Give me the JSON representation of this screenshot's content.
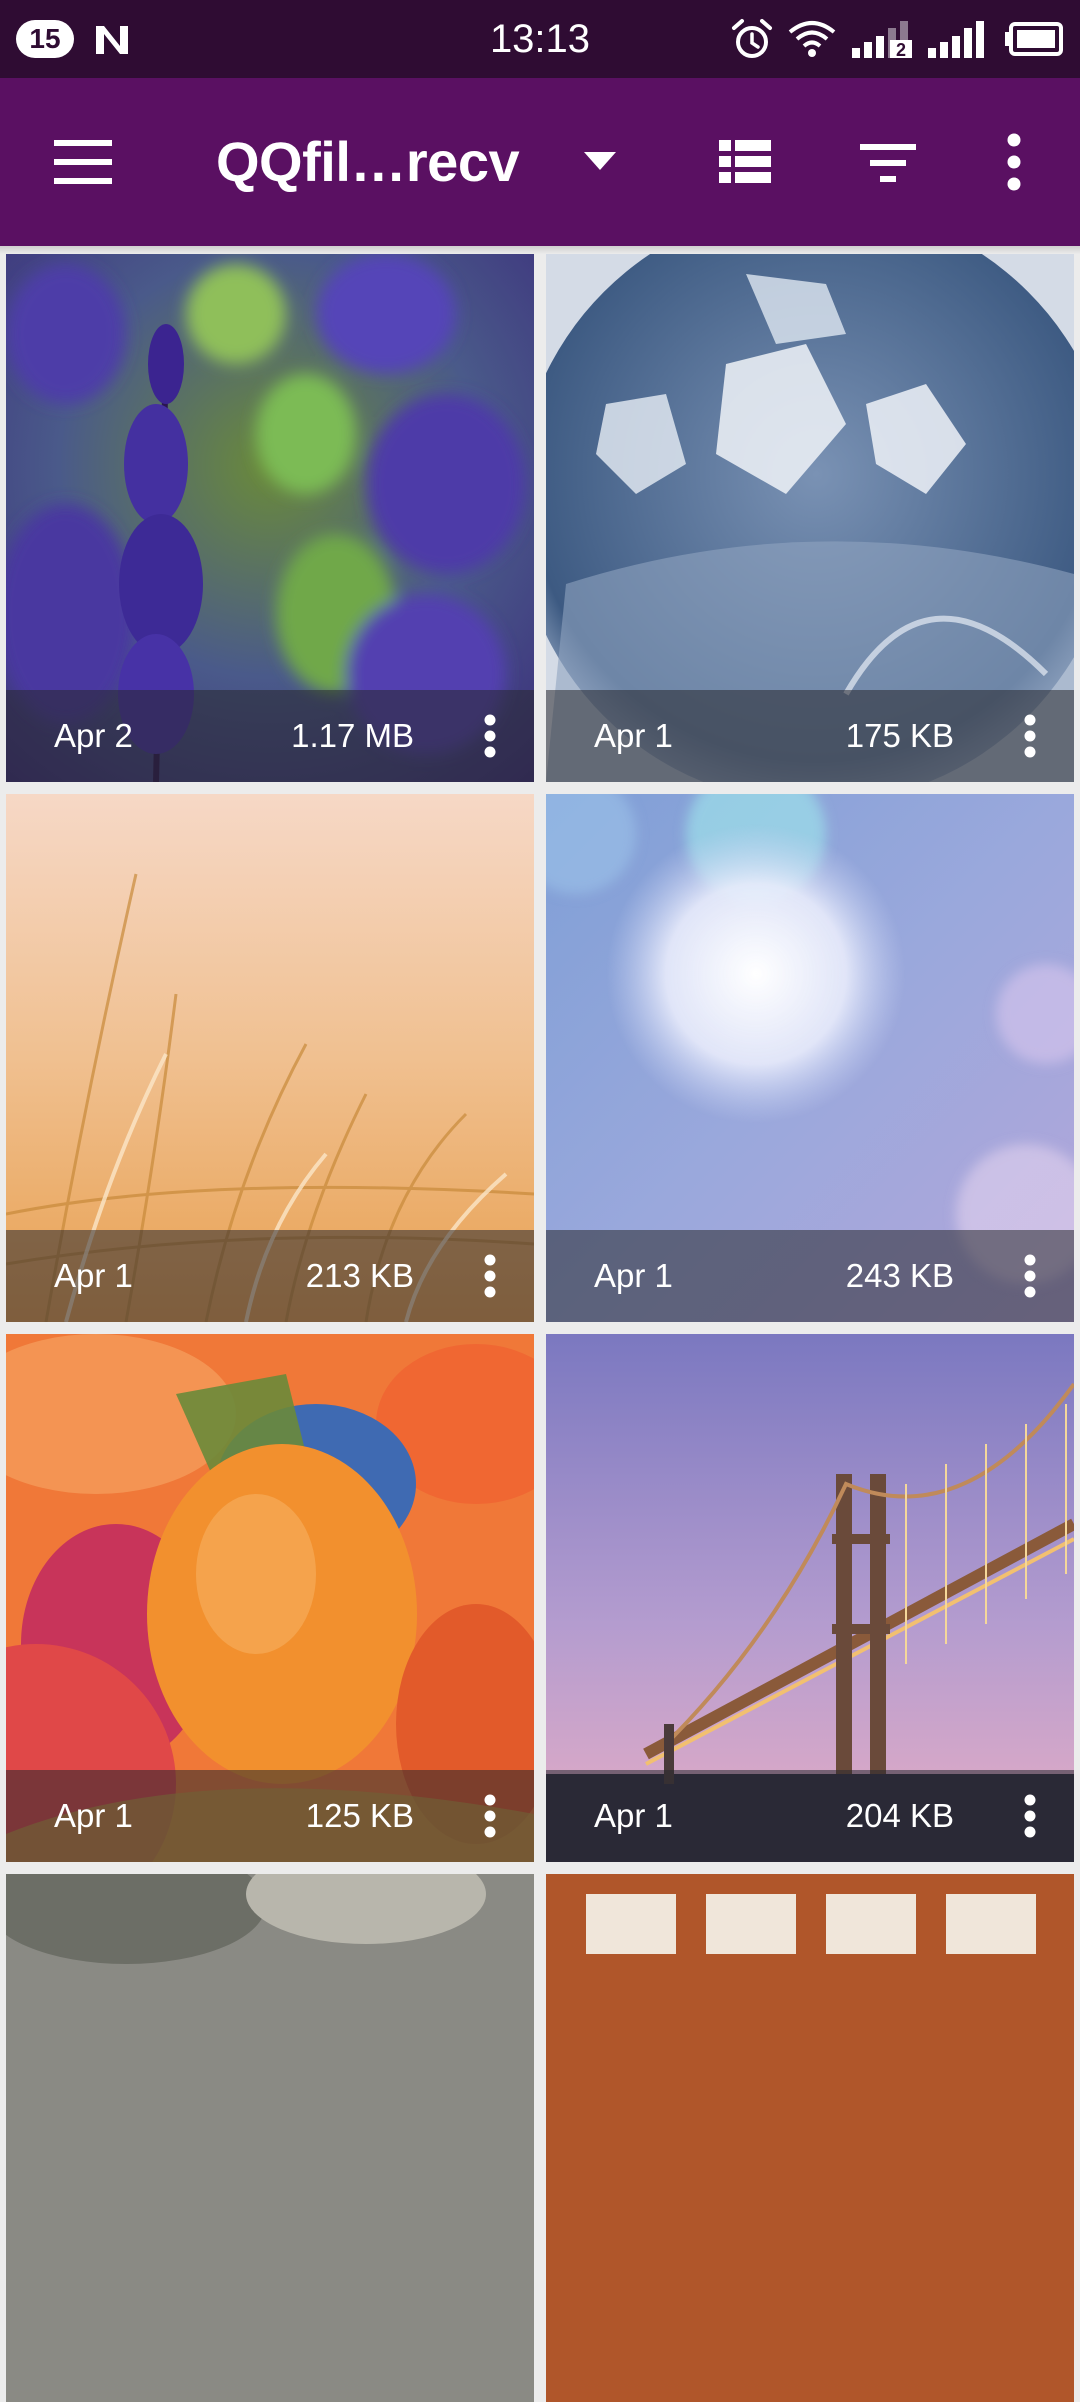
{
  "status_bar": {
    "notification_count": "15",
    "time": "13:13",
    "signal_sim2_label": "2",
    "icons": [
      "n-icon",
      "alarm-icon",
      "wifi-icon",
      "signal-icon",
      "signal-icon",
      "battery-icon"
    ]
  },
  "app_bar": {
    "title": "QQfil…recv",
    "icons": [
      "menu-icon",
      "dropdown-icon",
      "view-list-icon",
      "filter-icon",
      "more-vert-icon"
    ]
  },
  "colors": {
    "status_bar": "#2f0c33",
    "app_bar": "#5a1062",
    "background": "#ececec"
  },
  "grid": {
    "items": [
      {
        "subject": "lavender",
        "date": "Apr 2",
        "size": "1.17 MB"
      },
      {
        "subject": "frozen bubble",
        "date": "Apr 1",
        "size": "175 KB"
      },
      {
        "subject": "golden grass",
        "date": "Apr 1",
        "size": "213 KB"
      },
      {
        "subject": "bokeh lights",
        "date": "Apr 1",
        "size": "243 KB"
      },
      {
        "subject": "easter eggs",
        "date": "Apr 1",
        "size": "125 KB"
      },
      {
        "subject": "bridge at dusk",
        "date": "Apr 1",
        "size": "204 KB"
      },
      {
        "subject": "partial photo",
        "date": "",
        "size": ""
      },
      {
        "subject": "partial photo",
        "date": "",
        "size": ""
      }
    ]
  }
}
